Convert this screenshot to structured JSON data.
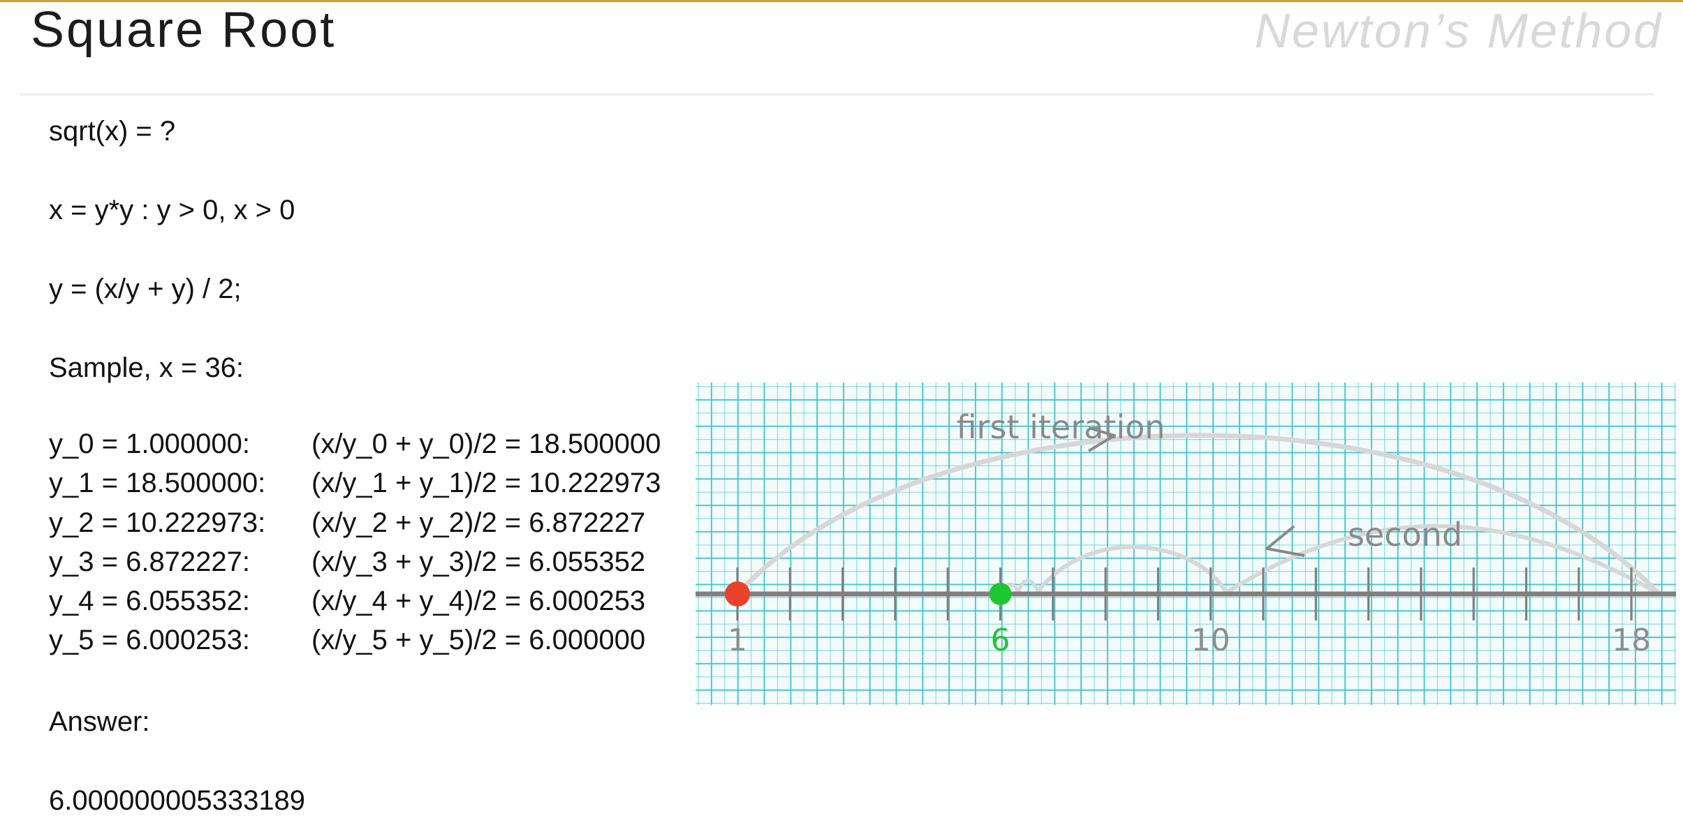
{
  "slide": {
    "title": "Square Root",
    "subtitle": "Newton’s Method"
  },
  "content": {
    "line1": "sqrt(x) = ?",
    "line2": "x = y*y : y > 0, x > 0",
    "line3": "y = (x/y + y) / 2;",
    "sample_label": "Sample, x = 36:",
    "iterations": [
      {
        "lhs": "y_0 = 1.000000:",
        "rhs": "(x/y_0 + y_0)/2 = 18.500000"
      },
      {
        "lhs": "y_1 = 18.500000:",
        "rhs": "(x/y_1 + y_1)/2 = 10.222973"
      },
      {
        "lhs": "y_2 = 10.222973:",
        "rhs": "(x/y_2 + y_2)/2 = 6.872227"
      },
      {
        "lhs": "y_3 = 6.872227:",
        "rhs": "(x/y_3 + y_3)/2 = 6.055352"
      },
      {
        "lhs": "y_4 = 6.055352:",
        "rhs": "(x/y_4 + y_4)/2 = 6.000253"
      },
      {
        "lhs": "y_5 = 6.000253:",
        "rhs": "(x/y_5 + y_5)/2 = 6.000000"
      }
    ],
    "answer_label": "Answer:",
    "answer_value": "6.000000005333189"
  },
  "figure": {
    "tick_labels": [
      "1",
      "6",
      "10",
      "18"
    ],
    "annotation_first": "first iteration",
    "annotation_second": "second",
    "colors": {
      "grid": "#3cc3cf",
      "axis": "#7f7f7f",
      "start_point": "#e8412c",
      "root_point": "#1fc633",
      "root_label": "#1fc633",
      "arc": "#d7d7d7",
      "label": "#8e8e8e"
    }
  }
}
